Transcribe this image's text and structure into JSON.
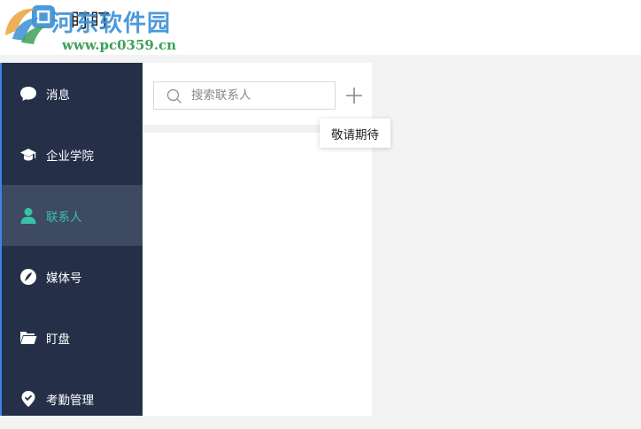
{
  "app": {
    "title": "盯盯"
  },
  "watermark": {
    "title": "河东软件园",
    "url": "www.pc0359.cn"
  },
  "sidebar": {
    "items": [
      {
        "label": "消息",
        "icon": "message-bubble-icon",
        "active": false
      },
      {
        "label": "企业学院",
        "icon": "graduation-cap-icon",
        "active": false
      },
      {
        "label": "联系人",
        "icon": "contact-person-icon",
        "active": true
      },
      {
        "label": "媒体号",
        "icon": "feather-icon",
        "active": false
      },
      {
        "label": "盯盘",
        "icon": "folder-icon",
        "active": false
      },
      {
        "label": "考勤管理",
        "icon": "location-pin-icon",
        "active": false
      }
    ]
  },
  "contacts": {
    "search": {
      "placeholder": "搜索联系人",
      "value": ""
    },
    "add_icon": "plus-icon"
  },
  "tooltip": {
    "text": "敬请期待"
  },
  "colors": {
    "sidebar_bg": "#253048",
    "sidebar_active_bg": "#3d4a62",
    "accent": "#37c3a8",
    "watermark_blue": "#3a8fd6",
    "watermark_green": "#3ea05a"
  }
}
